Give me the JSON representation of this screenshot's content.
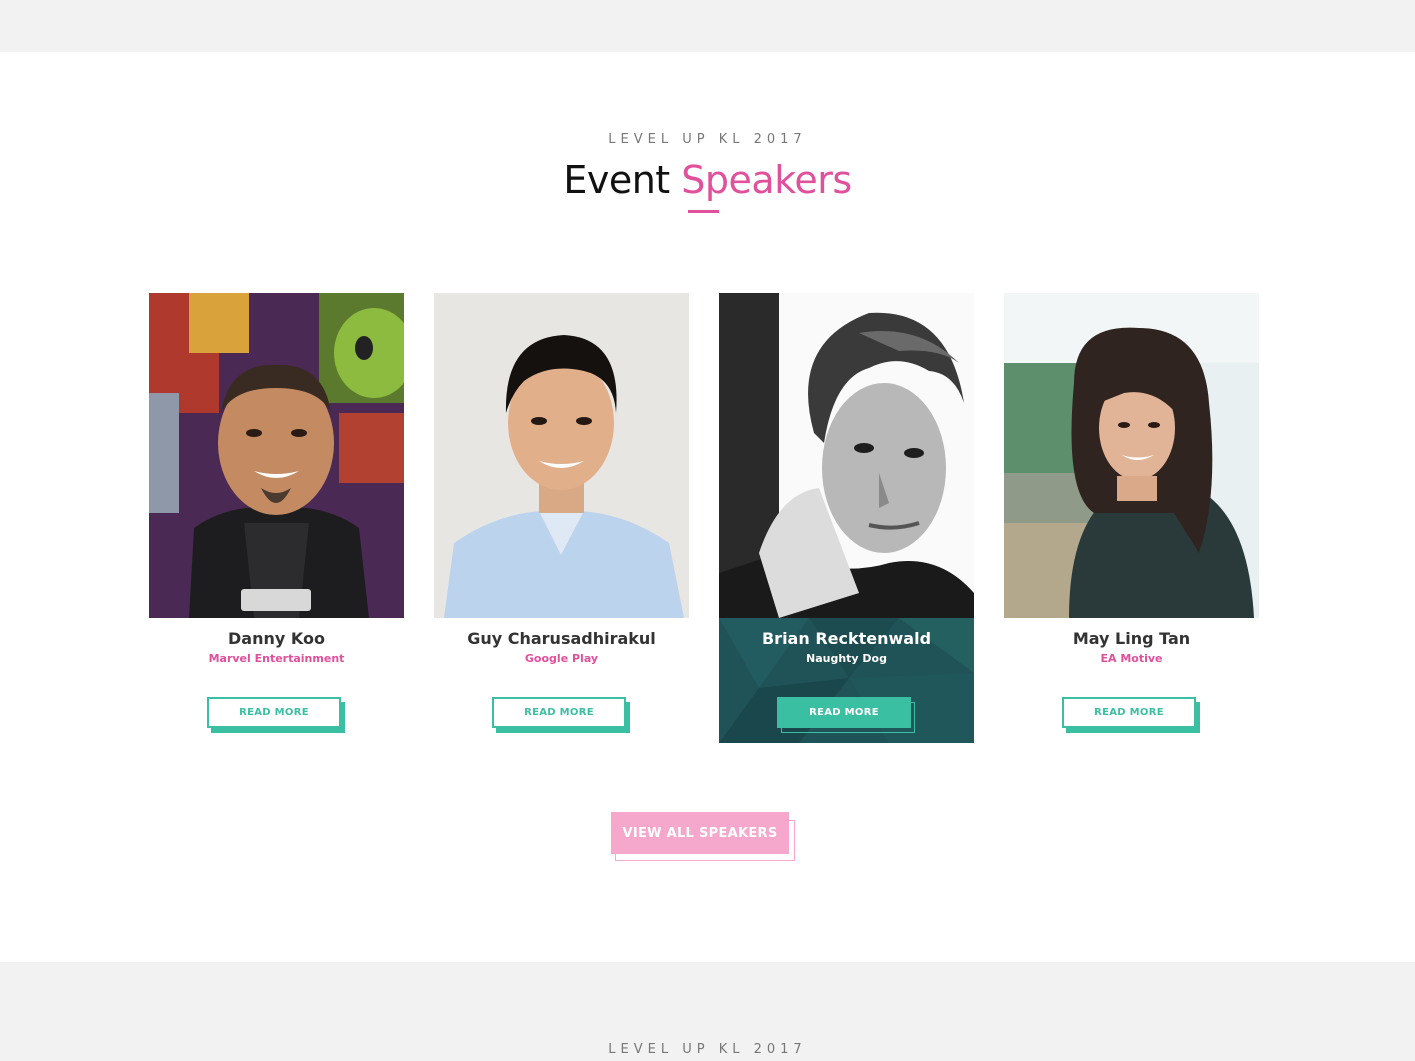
{
  "section": {
    "eyebrow": "LEVEL UP KL 2017",
    "heading_plain": "Event",
    "heading_accent": "Speakers",
    "accent_color": "#e0509b",
    "button_color": "#3bbfa2",
    "active_card_color": "#1f5357"
  },
  "speakers": [
    {
      "name": "Danny Koo",
      "company": "Marvel Entertainment",
      "read_more": "READ MORE"
    },
    {
      "name": "Guy Charusadhirakul",
      "company": "Google Play",
      "read_more": "READ MORE"
    },
    {
      "name": "Brian Recktenwald",
      "company": "Naughty Dog",
      "read_more": "READ MORE",
      "active": true
    },
    {
      "name": "May Ling Tan",
      "company": "EA Motive",
      "read_more": "READ MORE"
    }
  ],
  "view_all": {
    "label": "VIEW ALL SPEAKERS",
    "color": "#f5a8cb"
  },
  "next_section": {
    "eyebrow": "LEVEL UP KL 2017"
  }
}
